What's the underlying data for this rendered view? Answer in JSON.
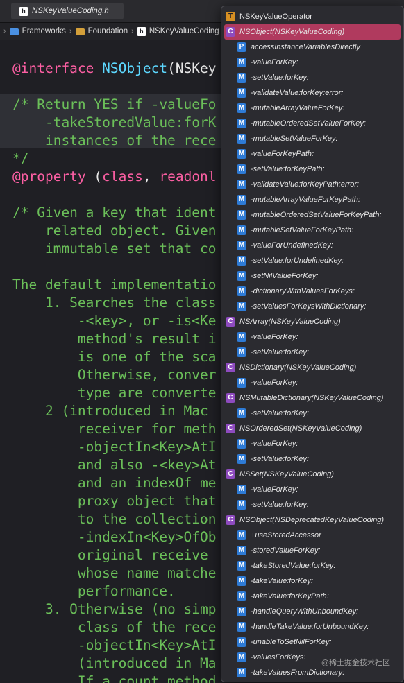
{
  "tab": {
    "title": "NSKeyValueCoding.h"
  },
  "breadcrumb": {
    "items": [
      "Frameworks",
      "Foundation",
      "NSKeyValueCoding"
    ]
  },
  "code": {
    "lines": [
      "@interface NSObject(NSKey",
      "",
      "/* Return YES if -valueFo",
      "    -takeStoredValue:forK",
      "    instances of the rece",
      "*/",
      "@property (class, readonl",
      "",
      "/* Given a key that ident",
      "    related object. Given",
      "    immutable set that co",
      "",
      "The default implementatio",
      "    1. Searches the class",
      "        -<key>, or -is<Ke",
      "        method's result i",
      "        is one of the sca",
      "        Otherwise, conver",
      "        type are converte",
      "    2 (introduced in Mac",
      "        receiver for meth",
      "        -objectIn<Key>AtI",
      "        and also -<key>At",
      "        and an indexOf me",
      "        proxy object that",
      "        to the collection",
      "        -indexIn<Key>OfOb",
      "        original receive",
      "        whose name matche",
      "        performance.",
      "    3. Otherwise (no simp",
      "        class of the rece",
      "        -objectIn<Key>AtI",
      "        (introduced in Ma",
      "        If a count method"
    ]
  },
  "popup": {
    "items": [
      {
        "badge": "T",
        "label": "NSKeyValueOperator"
      },
      {
        "badge": "C",
        "label": "NSObject(NSKeyValueCoding)",
        "selected": true
      },
      {
        "badge": "P",
        "label": "accessInstanceVariablesDirectly"
      },
      {
        "badge": "M",
        "label": "-valueForKey:"
      },
      {
        "badge": "M",
        "label": "-setValue:forKey:"
      },
      {
        "badge": "M",
        "label": "-validateValue:forKey:error:"
      },
      {
        "badge": "M",
        "label": "-mutableArrayValueForKey:"
      },
      {
        "badge": "M",
        "label": "-mutableOrderedSetValueForKey:"
      },
      {
        "badge": "M",
        "label": "-mutableSetValueForKey:"
      },
      {
        "badge": "M",
        "label": "-valueForKeyPath:"
      },
      {
        "badge": "M",
        "label": "-setValue:forKeyPath:"
      },
      {
        "badge": "M",
        "label": "-validateValue:forKeyPath:error:"
      },
      {
        "badge": "M",
        "label": "-mutableArrayValueForKeyPath:"
      },
      {
        "badge": "M",
        "label": "-mutableOrderedSetValueForKeyPath:"
      },
      {
        "badge": "M",
        "label": "-mutableSetValueForKeyPath:"
      },
      {
        "badge": "M",
        "label": "-valueForUndefinedKey:"
      },
      {
        "badge": "M",
        "label": "-setValue:forUndefinedKey:"
      },
      {
        "badge": "M",
        "label": "-setNilValueForKey:"
      },
      {
        "badge": "M",
        "label": "-dictionaryWithValuesForKeys:"
      },
      {
        "badge": "M",
        "label": "-setValuesForKeysWithDictionary:"
      },
      {
        "badge": "C",
        "label": "NSArray(NSKeyValueCoding)"
      },
      {
        "badge": "M",
        "label": "-valueForKey:"
      },
      {
        "badge": "M",
        "label": "-setValue:forKey:"
      },
      {
        "badge": "C",
        "label": "NSDictionary(NSKeyValueCoding)"
      },
      {
        "badge": "M",
        "label": "-valueForKey:"
      },
      {
        "badge": "C",
        "label": "NSMutableDictionary(NSKeyValueCoding)"
      },
      {
        "badge": "M",
        "label": "-setValue:forKey:"
      },
      {
        "badge": "C",
        "label": "NSOrderedSet(NSKeyValueCoding)"
      },
      {
        "badge": "M",
        "label": "-valueForKey:"
      },
      {
        "badge": "M",
        "label": "-setValue:forKey:"
      },
      {
        "badge": "C",
        "label": "NSSet(NSKeyValueCoding)"
      },
      {
        "badge": "M",
        "label": "-valueForKey:"
      },
      {
        "badge": "M",
        "label": "-setValue:forKey:"
      },
      {
        "badge": "C",
        "label": "NSObject(NSDeprecatedKeyValueCoding)"
      },
      {
        "badge": "M",
        "label": "+useStoredAccessor"
      },
      {
        "badge": "M",
        "label": "-storedValueForKey:"
      },
      {
        "badge": "M",
        "label": "-takeStoredValue:forKey:"
      },
      {
        "badge": "M",
        "label": "-takeValue:forKey:"
      },
      {
        "badge": "M",
        "label": "-takeValue:forKeyPath:"
      },
      {
        "badge": "M",
        "label": "-handleQueryWithUnboundKey:"
      },
      {
        "badge": "M",
        "label": "-handleTakeValue:forUnboundKey:"
      },
      {
        "badge": "M",
        "label": "-unableToSetNilForKey:"
      },
      {
        "badge": "M",
        "label": "-valuesForKeys:"
      },
      {
        "badge": "M",
        "label": "-takeValuesFromDictionary:"
      }
    ]
  },
  "watermark": "@稀土掘金技术社区"
}
